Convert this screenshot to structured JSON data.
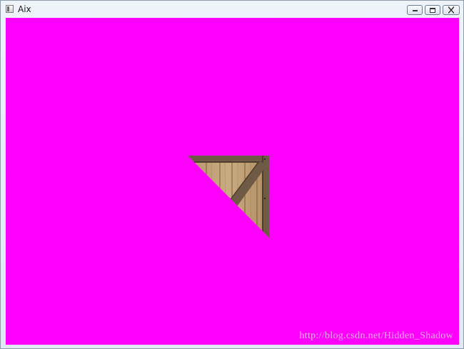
{
  "window": {
    "title": "Aix",
    "icon": "app-window-icon"
  },
  "caption_buttons": {
    "minimize": "minimize-icon",
    "maximize": "maximize-icon",
    "close": "close-icon"
  },
  "client": {
    "background_color": "#ff00ff",
    "texture": "wooden-crate-texture",
    "watermark": "http://blog.csdn.net/Hidden_Shadow"
  },
  "colors": {
    "clear_color": "#ff00ff",
    "wood_light": "#c4a47c",
    "wood_dark": "#6b5038"
  }
}
